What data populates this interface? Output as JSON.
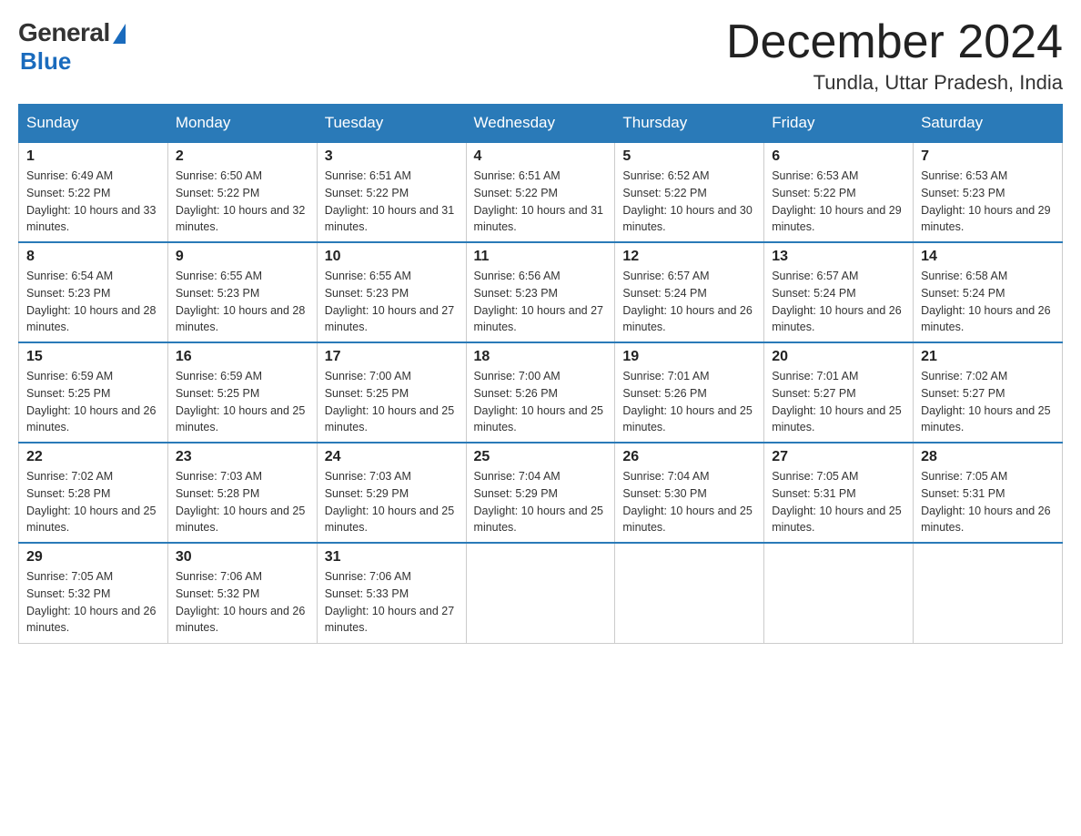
{
  "header": {
    "logo_general": "General",
    "logo_blue": "Blue",
    "month_title": "December 2024",
    "location": "Tundla, Uttar Pradesh, India"
  },
  "days_of_week": [
    "Sunday",
    "Monday",
    "Tuesday",
    "Wednesday",
    "Thursday",
    "Friday",
    "Saturday"
  ],
  "weeks": [
    [
      {
        "day": "1",
        "sunrise": "6:49 AM",
        "sunset": "5:22 PM",
        "daylight": "10 hours and 33 minutes."
      },
      {
        "day": "2",
        "sunrise": "6:50 AM",
        "sunset": "5:22 PM",
        "daylight": "10 hours and 32 minutes."
      },
      {
        "day": "3",
        "sunrise": "6:51 AM",
        "sunset": "5:22 PM",
        "daylight": "10 hours and 31 minutes."
      },
      {
        "day": "4",
        "sunrise": "6:51 AM",
        "sunset": "5:22 PM",
        "daylight": "10 hours and 31 minutes."
      },
      {
        "day": "5",
        "sunrise": "6:52 AM",
        "sunset": "5:22 PM",
        "daylight": "10 hours and 30 minutes."
      },
      {
        "day": "6",
        "sunrise": "6:53 AM",
        "sunset": "5:22 PM",
        "daylight": "10 hours and 29 minutes."
      },
      {
        "day": "7",
        "sunrise": "6:53 AM",
        "sunset": "5:23 PM",
        "daylight": "10 hours and 29 minutes."
      }
    ],
    [
      {
        "day": "8",
        "sunrise": "6:54 AM",
        "sunset": "5:23 PM",
        "daylight": "10 hours and 28 minutes."
      },
      {
        "day": "9",
        "sunrise": "6:55 AM",
        "sunset": "5:23 PM",
        "daylight": "10 hours and 28 minutes."
      },
      {
        "day": "10",
        "sunrise": "6:55 AM",
        "sunset": "5:23 PM",
        "daylight": "10 hours and 27 minutes."
      },
      {
        "day": "11",
        "sunrise": "6:56 AM",
        "sunset": "5:23 PM",
        "daylight": "10 hours and 27 minutes."
      },
      {
        "day": "12",
        "sunrise": "6:57 AM",
        "sunset": "5:24 PM",
        "daylight": "10 hours and 26 minutes."
      },
      {
        "day": "13",
        "sunrise": "6:57 AM",
        "sunset": "5:24 PM",
        "daylight": "10 hours and 26 minutes."
      },
      {
        "day": "14",
        "sunrise": "6:58 AM",
        "sunset": "5:24 PM",
        "daylight": "10 hours and 26 minutes."
      }
    ],
    [
      {
        "day": "15",
        "sunrise": "6:59 AM",
        "sunset": "5:25 PM",
        "daylight": "10 hours and 26 minutes."
      },
      {
        "day": "16",
        "sunrise": "6:59 AM",
        "sunset": "5:25 PM",
        "daylight": "10 hours and 25 minutes."
      },
      {
        "day": "17",
        "sunrise": "7:00 AM",
        "sunset": "5:25 PM",
        "daylight": "10 hours and 25 minutes."
      },
      {
        "day": "18",
        "sunrise": "7:00 AM",
        "sunset": "5:26 PM",
        "daylight": "10 hours and 25 minutes."
      },
      {
        "day": "19",
        "sunrise": "7:01 AM",
        "sunset": "5:26 PM",
        "daylight": "10 hours and 25 minutes."
      },
      {
        "day": "20",
        "sunrise": "7:01 AM",
        "sunset": "5:27 PM",
        "daylight": "10 hours and 25 minutes."
      },
      {
        "day": "21",
        "sunrise": "7:02 AM",
        "sunset": "5:27 PM",
        "daylight": "10 hours and 25 minutes."
      }
    ],
    [
      {
        "day": "22",
        "sunrise": "7:02 AM",
        "sunset": "5:28 PM",
        "daylight": "10 hours and 25 minutes."
      },
      {
        "day": "23",
        "sunrise": "7:03 AM",
        "sunset": "5:28 PM",
        "daylight": "10 hours and 25 minutes."
      },
      {
        "day": "24",
        "sunrise": "7:03 AM",
        "sunset": "5:29 PM",
        "daylight": "10 hours and 25 minutes."
      },
      {
        "day": "25",
        "sunrise": "7:04 AM",
        "sunset": "5:29 PM",
        "daylight": "10 hours and 25 minutes."
      },
      {
        "day": "26",
        "sunrise": "7:04 AM",
        "sunset": "5:30 PM",
        "daylight": "10 hours and 25 minutes."
      },
      {
        "day": "27",
        "sunrise": "7:05 AM",
        "sunset": "5:31 PM",
        "daylight": "10 hours and 25 minutes."
      },
      {
        "day": "28",
        "sunrise": "7:05 AM",
        "sunset": "5:31 PM",
        "daylight": "10 hours and 26 minutes."
      }
    ],
    [
      {
        "day": "29",
        "sunrise": "7:05 AM",
        "sunset": "5:32 PM",
        "daylight": "10 hours and 26 minutes."
      },
      {
        "day": "30",
        "sunrise": "7:06 AM",
        "sunset": "5:32 PM",
        "daylight": "10 hours and 26 minutes."
      },
      {
        "day": "31",
        "sunrise": "7:06 AM",
        "sunset": "5:33 PM",
        "daylight": "10 hours and 27 minutes."
      },
      null,
      null,
      null,
      null
    ]
  ],
  "sunrise_label": "Sunrise: ",
  "sunset_label": "Sunset: ",
  "daylight_label": "Daylight: "
}
